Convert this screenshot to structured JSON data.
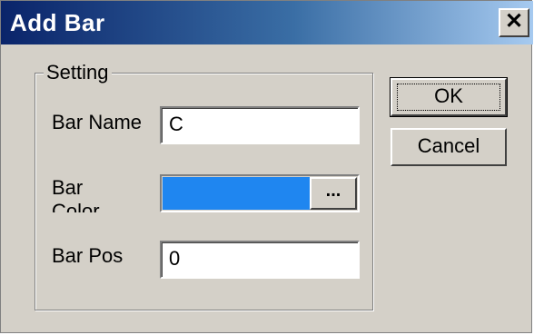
{
  "dialog": {
    "title": "Add Bar",
    "close_label": "✕",
    "group_label": "Setting",
    "bar_name": {
      "label": "Bar Name",
      "value": "C"
    },
    "bar_color": {
      "label_line1": "Bar",
      "label_line2": "Color",
      "color": "#1f86f0",
      "browse_label": "..."
    },
    "bar_pos": {
      "label": "Bar Pos",
      "value": "0"
    },
    "ok_label": "OK",
    "cancel_label": "Cancel"
  }
}
